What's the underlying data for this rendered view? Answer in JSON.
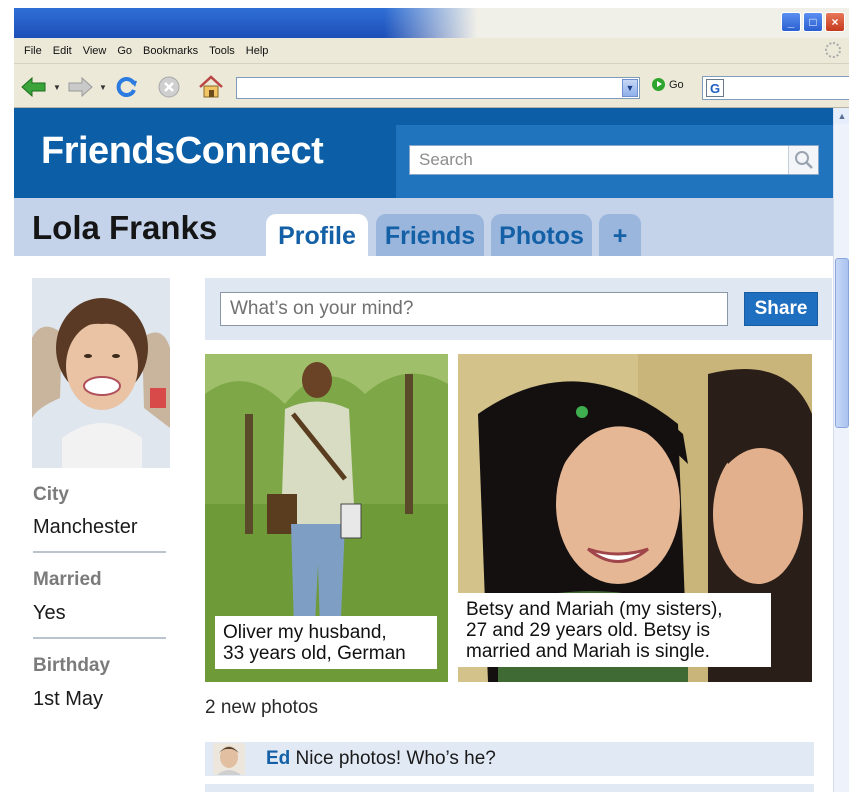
{
  "browser": {
    "menu": [
      "File",
      "Edit",
      "View",
      "Go",
      "Bookmarks",
      "Tools",
      "Help"
    ],
    "url": "",
    "go_label": "Go",
    "window_buttons": [
      "minimize",
      "maximize",
      "close"
    ]
  },
  "site": {
    "logo": "FriendsConnect",
    "search_placeholder": "Search"
  },
  "profile": {
    "name": "Lola Franks",
    "tabs": [
      {
        "label": "Profile",
        "active": true
      },
      {
        "label": "Friends",
        "active": false
      },
      {
        "label": "Photos",
        "active": false
      },
      {
        "label": "+",
        "active": false
      }
    ],
    "info": [
      {
        "label": "City",
        "value": "Manchester"
      },
      {
        "label": "Married",
        "value": "Yes"
      },
      {
        "label": "Birthday",
        "value": "1st May"
      }
    ]
  },
  "status": {
    "placeholder": "What’s on your mind?",
    "share_label": "Share"
  },
  "photos": {
    "items": [
      {
        "caption_lines": [
          "Oliver my husband,",
          "33 years old, German"
        ]
      },
      {
        "caption_lines": [
          "Betsy and Mariah (my sisters),",
          "27 and 29 years old. Betsy is",
          "married and Mariah is single."
        ]
      }
    ],
    "count_label": "2 new photos"
  },
  "comments": [
    {
      "author": "Ed",
      "text": " Nice photos! Who’s he?"
    }
  ],
  "colors": {
    "header_blue": "#0c5fa6",
    "tab_inactive": "#9ab6dd",
    "subheader": "#c4d2ea",
    "share_button": "#1f6fc0",
    "link_blue": "#1360a6"
  }
}
